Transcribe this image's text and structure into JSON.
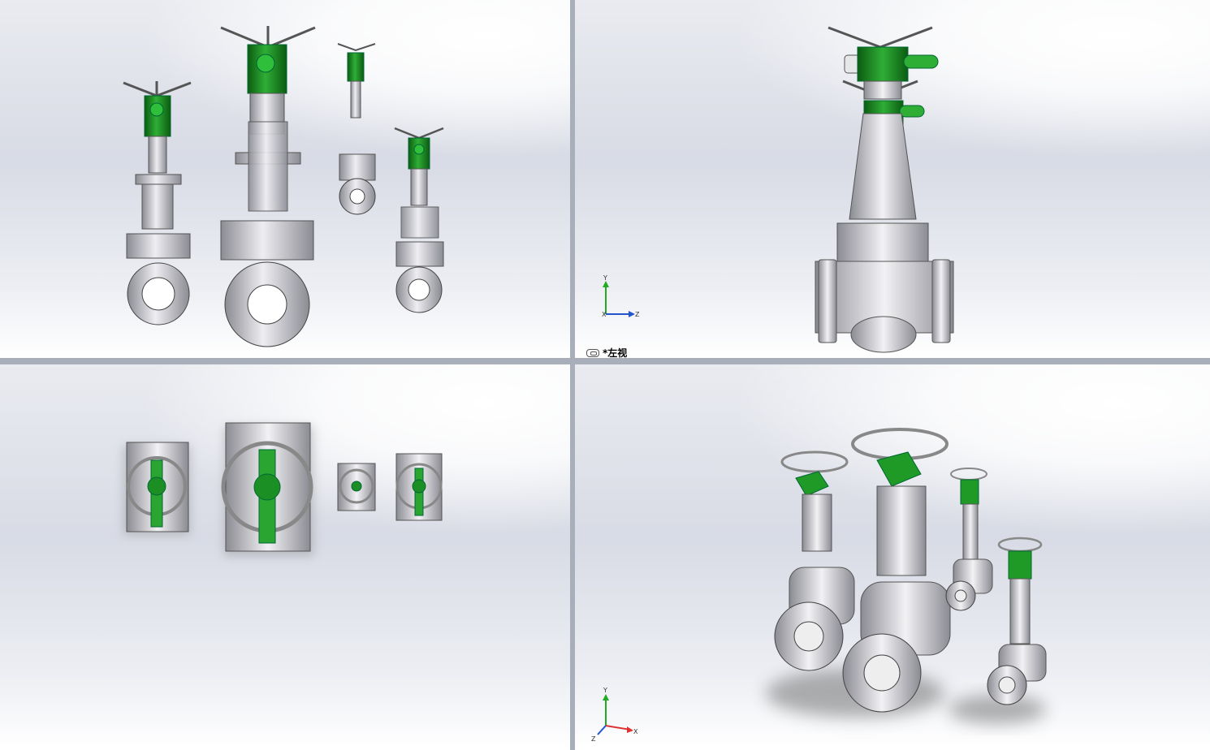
{
  "viewports": {
    "top_left": {
      "label": ""
    },
    "top_right": {
      "label": "*左视"
    },
    "bottom_left": {
      "label": ""
    },
    "bottom_right": {
      "label": ""
    }
  },
  "triad": {
    "x": "X",
    "y": "Y",
    "z": "Z"
  },
  "colors": {
    "steel": "#c9c9cf",
    "steel_dark": "#7d7d86",
    "actuator_green": "#1a8a22",
    "actuator_green_dark": "#0b5c11",
    "axis_x": "#d33",
    "axis_y": "#2a2",
    "axis_z": "#25c"
  }
}
